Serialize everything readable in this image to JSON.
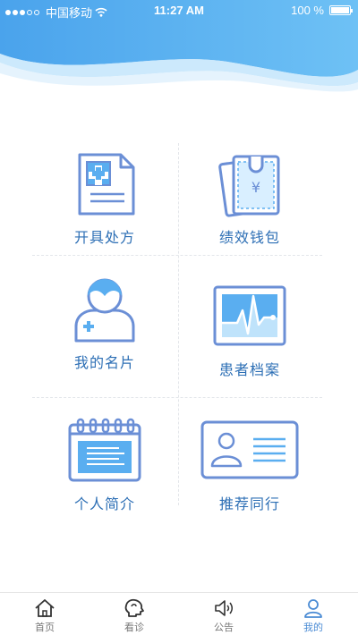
{
  "status_bar": {
    "carrier": "中国移动",
    "time": "11:27 AM",
    "battery": "100 %"
  },
  "grid": {
    "items": [
      {
        "label": "开具处方",
        "icon": "prescription-icon"
      },
      {
        "label": "绩效钱包",
        "icon": "wallet-icon"
      },
      {
        "label": "我的名片",
        "icon": "user-card-icon"
      },
      {
        "label": "患者档案",
        "icon": "patient-record-icon"
      },
      {
        "label": "个人简介",
        "icon": "profile-intro-icon"
      },
      {
        "label": "推荐同行",
        "icon": "recommend-peer-icon"
      }
    ]
  },
  "tabbar": {
    "tabs": [
      {
        "label": "首页",
        "icon": "home-icon",
        "active": false
      },
      {
        "label": "看诊",
        "icon": "consult-icon",
        "active": false
      },
      {
        "label": "公告",
        "icon": "announcement-icon",
        "active": false
      },
      {
        "label": "我的",
        "icon": "profile-icon",
        "active": true
      }
    ]
  },
  "colors": {
    "accent": "#5aaef0",
    "icon_stroke": "#6b8fd6",
    "label": "#2d6fb5",
    "active_tab": "#4a8bd4"
  }
}
